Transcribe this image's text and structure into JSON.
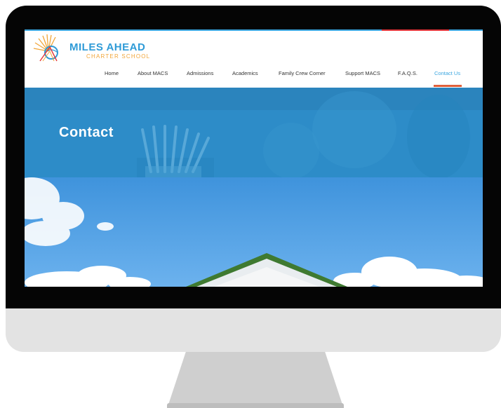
{
  "site": {
    "logo": {
      "title": "MILES AHEAD",
      "subtitle": "CHARTER SCHOOL",
      "icon": "sun-globe-logo"
    },
    "nav": [
      {
        "label": "Home"
      },
      {
        "label": "About MACS"
      },
      {
        "label": "Admissions"
      },
      {
        "label": "Academics"
      },
      {
        "label": "Family Crew Corner"
      },
      {
        "label": "Support MACS"
      },
      {
        "label": "F.A.Q.S."
      },
      {
        "label": "Contact Us",
        "active": true
      }
    ],
    "hero": {
      "title": "Contact"
    }
  },
  "colors": {
    "brand_blue": "#2f9bd7",
    "brand_orange": "#f1a63a",
    "active_nav": "#3ba6e0",
    "nav_underline": "#e0603a",
    "hero_overlay": "#2d8cc8",
    "accent_red": "#e3353a"
  }
}
